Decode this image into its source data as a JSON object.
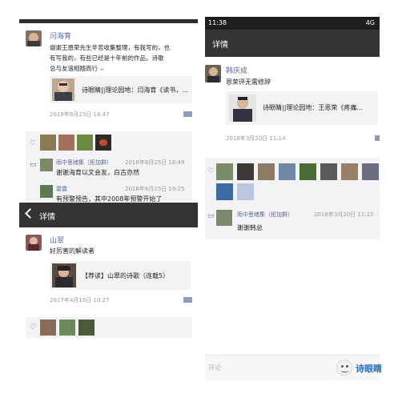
{
  "panel_a": {
    "author": "闫海育",
    "text_lines": [
      "谢谢王恩荣先生辛苦收集整理，有我写的，也",
      "有写我的，有些已经是十年前的作品，诗歌",
      "总与友谊相随而行"
    ],
    "link_title": "诗眼睛||理论园地：闫海育《读书，...",
    "time": "2018年8月25日 18:47",
    "comments": [
      {
        "name": "雨中思绪集（拒加群）",
        "time": "2018年8月25日 18:49",
        "text": "谢谢海育以文会友，白古亦然"
      },
      {
        "name": "雷震",
        "time": "2018年8月25日 19:25",
        "text": "有预警预告，其中2008年预警开始了"
      }
    ]
  },
  "panel_b": {
    "status_time": "11:38",
    "status_signal": "4G",
    "title": "详情",
    "author": "韩庆成",
    "text": "恩荣评无需修辞",
    "link_title": "诗眼睛||理论园地：王恩荣《疼痛...",
    "time": "2018年3月20日 11:14",
    "comment": {
      "name": "雨中思绪集（拒加群）",
      "time": "2018年3月20日 11:15",
      "text": "谢谢韩总"
    },
    "input_placeholder": "评论",
    "watermark": "诗眼睛"
  },
  "panel_c": {
    "title": "详情",
    "author": "山翠",
    "text": "好厉害的解读者",
    "link_title": "【荐读】山翠的诗歌（连载5）",
    "time": "2017年4月16日 10:27"
  }
}
